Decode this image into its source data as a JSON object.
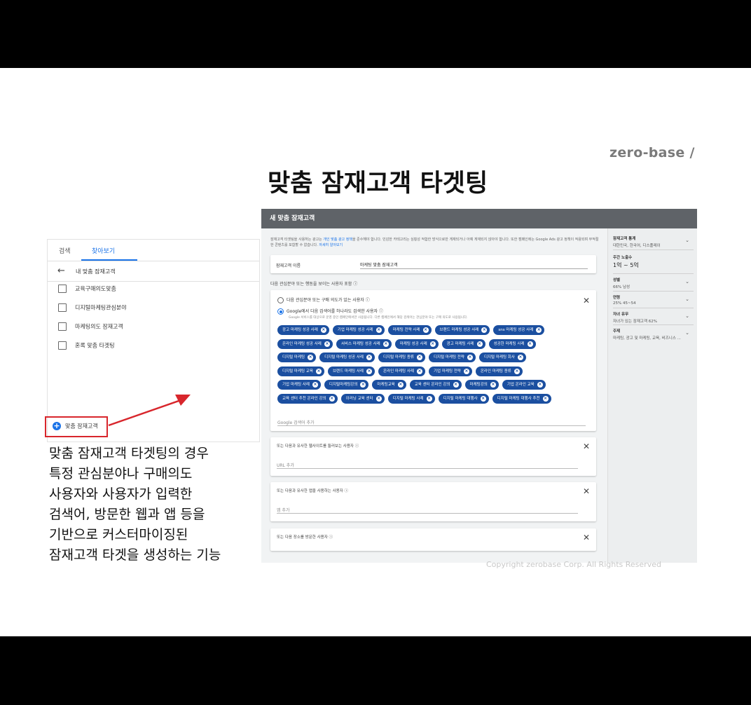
{
  "brand": "zero-base /",
  "slide_title": "맞춤 잠재고객 타겟팅",
  "left_panel": {
    "tabs": [
      "검색",
      "찾아보기"
    ],
    "back_label": "내 맞춤 잠재고객",
    "items": [
      "교육구매의도맞춤",
      "디지털마케팅관심분야",
      "마케팅의도 잠재고객",
      "혼록 맞춤 타겟팅"
    ],
    "add_label": "맞춤 잠재고객"
  },
  "description_lines": [
    "맞춤 잠재고객 타겟팅의 경우",
    "특정 관심분야나 구매의도",
    "사용자와 사용자가 입력한",
    "검색어, 방문한 웹과 앱 등을",
    "기반으로 커스터마이징된",
    "잠재고객 타겟을 생성하는 기능"
  ],
  "main_panel": {
    "header": "새 맞춤 잠재고객",
    "info_text": "잠재고객 타겟팅을 사용하는 광고는 ",
    "info_link": "개인 맞춤 광고 정책",
    "info_text2": "을 준수해야 합니다. 민감한 카테고리는 심횡성 적합한 방식으로만 게재되거나 아예 게재되지 않아야 합니다. 또한 캠페인에는 Google Ads 광고 정책이 적용되며 부적절한 콘텐츠를 포함할 수 없습니다. ",
    "info_link2": "자세히 알아보기",
    "name_label": "잠재고객 이름",
    "name_value": "마케팅 맞춤 잠재고객",
    "section_label": "다음 관심분야 또는 행동을 보이는 사용자 포함 ⓘ",
    "radio1": "다음 관심분야 또는 구매 의도가 있는 사용자 ⓘ",
    "radio2": "Google에서 다음 검색어를 하나라도 검색한 사용자 ⓘ",
    "radio2_note": "Google 서비스를 대상으로 운영 중인 캠페인에서만 사용됩니다. 다른 캠페인에서 해당 검색어는 관심분야 또는 구매 의도로 사용됩니다.",
    "chip_rows": [
      [
        "광고 마케팅 성공 사례",
        "기업 마케팅 성공 사례",
        "마케팅 전략 사례",
        "브랜드 마케팅 성공 사례",
        "sns 마케팅 성공 사례"
      ],
      [
        "온라인 마케팅 성공 사례",
        "서비스 마케팅 성공 사례",
        "마케팅 성공 사례",
        "광고 마케팅 사례",
        "성공한 마케팅 사례"
      ],
      [
        "디지털 마케팅",
        "디지털 마케팅 성공 사례",
        "디지털 마케팅 종류",
        "디지털 마케팅 전략",
        "디지털 마케팅 회사"
      ],
      [
        "디지털 마케팅 교육",
        "브랜드 마케팅 사례",
        "온라인 마케팅 사례",
        "기업 마케팅 전략",
        "온라인 마케팅 종류"
      ],
      [
        "기업 마케팅 사례",
        "디지털마케팅강의",
        "마케팅교육",
        "교육 센터 온라인 강의",
        "마케팅강의",
        "기업 온라인 교육"
      ],
      [
        "교육 센터 추천 온라인 강의",
        "이러닝 교육 센터",
        "디지털 마케팅 사례",
        "디지털 마케팅 대행사",
        "디지털 마케팅 대행사 추천"
      ]
    ],
    "keyword_placeholder": "Google 검색어 추가",
    "url_card_label": "또는 다음과 유사한 웹사이트를 둘러보는 사용자 ⓘ",
    "url_placeholder": "URL 추가",
    "app_card_label": "또는 다음과 유사한 앱을 사용하는 사용자 ⓘ",
    "app_placeholder": "앱 추가",
    "place_card_label": "또는 다음 장소를 방문한 사용자 ⓘ",
    "close_glyph": "✕",
    "sidebar": [
      {
        "title": "잠재고객 통계",
        "value": "대한민국, 한국어, 디스플레이"
      },
      {
        "title": "주간 노출수",
        "value": "1억 ~ 5억"
      },
      {
        "title": "성별",
        "value": "66% 남성"
      },
      {
        "title": "연령",
        "value": "25% 45~54"
      },
      {
        "title": "자녀 유무",
        "value": "자녀가 있는 잠재고객 62%"
      },
      {
        "title": "주제",
        "value": "마케팅, 광고 및 마케팅, 교육, 비즈니스 ..."
      }
    ]
  },
  "copyright": "Copyright zerobase Corp. All Rights Reserved",
  "colors": {
    "accent": "#1a73e8",
    "chip": "#1b4fa0",
    "highlight": "#d8262c",
    "header": "#5f6368"
  }
}
